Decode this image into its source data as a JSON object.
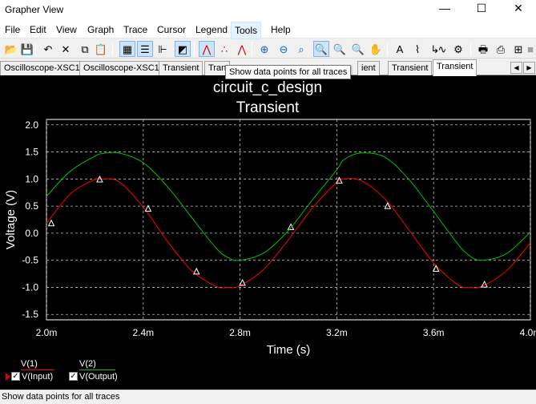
{
  "window": {
    "title": "Grapher View",
    "controls": {
      "minimize": "—",
      "maximize": "☐",
      "close": "✕"
    }
  },
  "menu": [
    {
      "label": "File"
    },
    {
      "label": "Edit"
    },
    {
      "label": "View"
    },
    {
      "label": "Graph"
    },
    {
      "label": "Trace"
    },
    {
      "label": "Cursor"
    },
    {
      "label": "Legend"
    },
    {
      "label": "Tools"
    },
    {
      "label": "Help"
    }
  ],
  "toolbar": [
    {
      "name": "open",
      "glyph": "📂"
    },
    {
      "name": "save",
      "glyph": "💾"
    },
    {
      "name": "undo",
      "glyph": "↶"
    },
    {
      "name": "cut",
      "glyph": "✕"
    },
    {
      "name": "copy",
      "glyph": "⧉"
    },
    {
      "name": "paste",
      "glyph": "📋"
    },
    {
      "name": "grid",
      "glyph": "▦",
      "pressed": true
    },
    {
      "name": "legend",
      "glyph": "☰",
      "pressed": true
    },
    {
      "name": "cursors",
      "glyph": "⊩"
    },
    {
      "name": "reverse-colors",
      "glyph": "◩",
      "pressed": true
    },
    {
      "name": "show-lines",
      "glyph": "⋀",
      "pressed": true
    },
    {
      "name": "show-points",
      "glyph": "∴"
    },
    {
      "name": "show-lines-points",
      "glyph": "⋀"
    },
    {
      "name": "zoom-in",
      "glyph": "⊕"
    },
    {
      "name": "zoom-out",
      "glyph": "⊖"
    },
    {
      "name": "zoom-area",
      "glyph": "⌕"
    },
    {
      "name": "zoom-full",
      "glyph": "🔍",
      "pressed": true
    },
    {
      "name": "zoom-x",
      "glyph": "🔍"
    },
    {
      "name": "zoom-y",
      "glyph": "🔍"
    },
    {
      "name": "pan",
      "glyph": "✋"
    },
    {
      "name": "title",
      "glyph": "A"
    },
    {
      "name": "text",
      "glyph": "⌇"
    },
    {
      "name": "overlay",
      "glyph": "↳"
    },
    {
      "name": "trace-properties",
      "glyph": "∿"
    },
    {
      "name": "graph-properties",
      "glyph": "⚙"
    },
    {
      "name": "print",
      "glyph": "🖶"
    },
    {
      "name": "export",
      "glyph": "⎙"
    },
    {
      "name": "export-excel",
      "glyph": "⊞"
    },
    {
      "name": "stop",
      "glyph": "■"
    }
  ],
  "tabs": [
    "Oscilloscope-XSC1",
    "Oscilloscope-XSC1",
    "Transient",
    "Tran",
    "ient",
    "Transient",
    "Transient"
  ],
  "tab_scroll": {
    "left": "◀",
    "right": "▶"
  },
  "tooltip": "Show data points for all traces",
  "legend": [
    {
      "name": "V(1)",
      "label": "V(Input)",
      "color": "#ff0000",
      "checked": "✓"
    },
    {
      "name": "V(2)",
      "label": "V(Output)",
      "color": "#00c000",
      "checked": "✓"
    }
  ],
  "status": "Show data points for all traces",
  "chart_data": {
    "type": "line",
    "title": "circuit_c_design",
    "subtitle": "Transient",
    "xlabel": "Time (s)",
    "ylabel": "Voltage (V)",
    "xlim": [
      0.002,
      0.004
    ],
    "ylim": [
      -1.6,
      2.1
    ],
    "xticks": [
      0.002,
      0.0024,
      0.0028,
      0.0032,
      0.0036,
      0.004
    ],
    "xtick_labels": [
      "2.0m",
      "2.4m",
      "2.8m",
      "3.2m",
      "3.6m",
      "4.0m"
    ],
    "yticks": [
      -1.5,
      -1.0,
      -0.5,
      0.0,
      0.5,
      1.0,
      1.5,
      2.0
    ],
    "ytick_labels": [
      "-1.5",
      "-1.0",
      "-0.5",
      "0.0",
      "0.5",
      "1.0",
      "1.5",
      "2.0"
    ],
    "grid": true,
    "background": "#000000",
    "x": [
      0.002,
      0.0021,
      0.0022,
      0.00223,
      0.0023,
      0.0024,
      0.0025,
      0.0026,
      0.0027,
      0.00275,
      0.0028,
      0.0029,
      0.003,
      0.0031,
      0.0032,
      0.00323,
      0.0033,
      0.0034,
      0.0035,
      0.0036,
      0.0037,
      0.00375,
      0.0038,
      0.0039,
      0.004
    ],
    "series": [
      {
        "name": "V(Input)",
        "color": "#ff0000",
        "values": [
          0.18,
          0.73,
          0.99,
          1.0,
          0.95,
          0.48,
          -0.15,
          -0.69,
          -0.98,
          -1.0,
          -0.97,
          -0.66,
          -0.12,
          0.47,
          0.94,
          1.0,
          0.97,
          0.63,
          0.05,
          -0.55,
          -0.95,
          -1.0,
          -0.98,
          -0.7,
          -0.18
        ],
        "markers": [
          {
            "x": 0.00202,
            "y": 0.18
          },
          {
            "x": 0.00222,
            "y": 0.99
          },
          {
            "x": 0.00242,
            "y": 0.45
          },
          {
            "x": 0.00262,
            "y": -0.71
          },
          {
            "x": 0.00281,
            "y": -0.92
          },
          {
            "x": 0.00301,
            "y": 0.11
          },
          {
            "x": 0.00321,
            "y": 0.97
          },
          {
            "x": 0.00341,
            "y": 0.5
          },
          {
            "x": 0.00361,
            "y": -0.66
          },
          {
            "x": 0.00381,
            "y": -0.95
          }
        ]
      },
      {
        "name": "V(Output)",
        "color": "#00c000",
        "values": [
          0.68,
          1.15,
          1.42,
          1.47,
          1.48,
          1.3,
          0.86,
          0.29,
          -0.27,
          -0.45,
          -0.5,
          -0.36,
          0.05,
          0.62,
          1.17,
          1.36,
          1.48,
          1.4,
          0.98,
          0.4,
          -0.2,
          -0.42,
          -0.5,
          -0.38,
          0.02
        ]
      }
    ]
  }
}
